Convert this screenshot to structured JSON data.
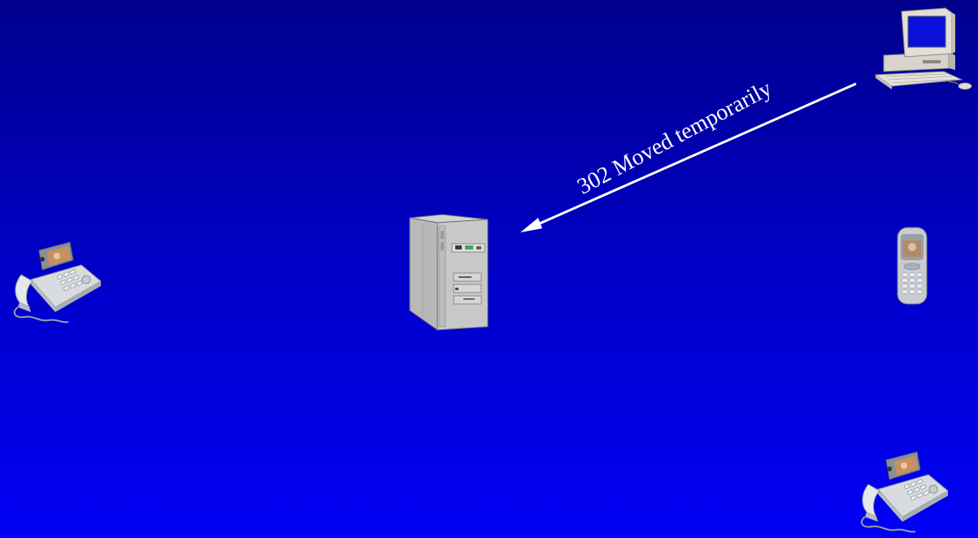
{
  "message": {
    "label": "302 Moved temporarily",
    "color": "#ffffff"
  },
  "devices": [
    {
      "name": "video-phone",
      "icon": "video-phone-icon",
      "position": "left"
    },
    {
      "name": "proxy-server",
      "icon": "server-tower-icon",
      "position": "center"
    },
    {
      "name": "desktop-computer",
      "icon": "desktop-computer-icon",
      "position": "top-right"
    },
    {
      "name": "mobile-phone",
      "icon": "mobile-phone-icon",
      "position": "right"
    },
    {
      "name": "video-phone",
      "icon": "video-phone-icon",
      "position": "bottom-right"
    }
  ],
  "colors": {
    "background_top": "#00008c",
    "background_bottom": "#0000f5",
    "arrow": "#ffffff"
  }
}
